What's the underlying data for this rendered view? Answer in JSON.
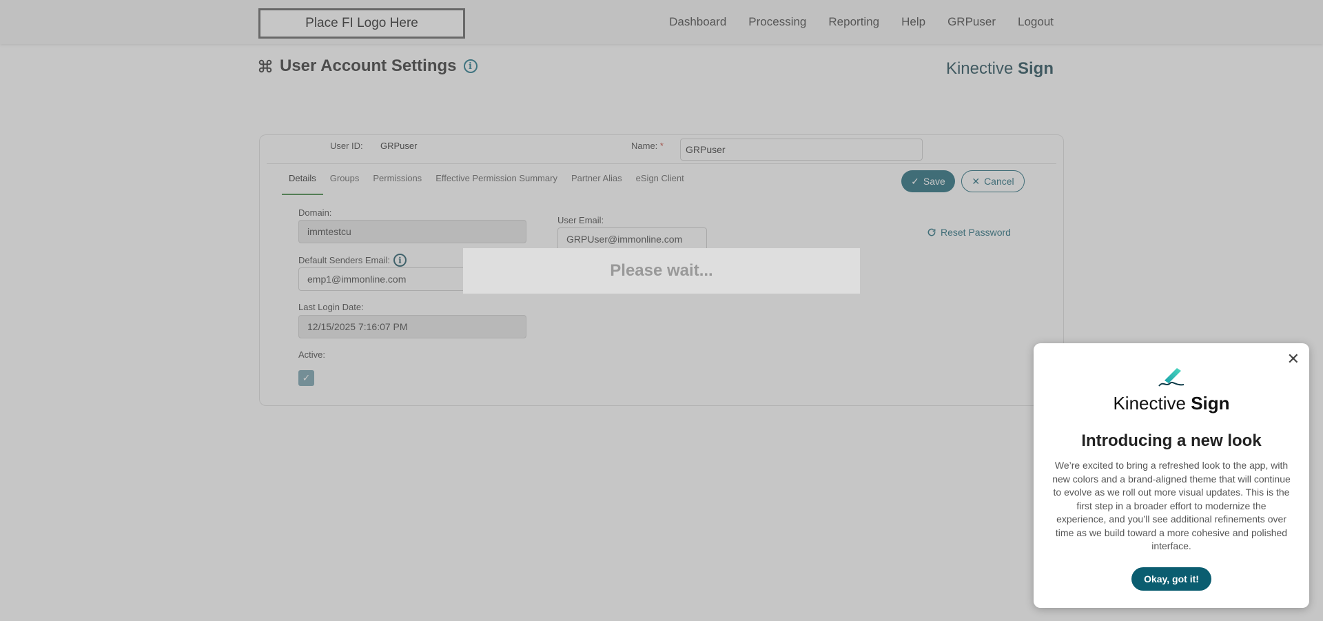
{
  "header": {
    "logo_text": "Place FI Logo Here",
    "nav": [
      "Dashboard",
      "Processing",
      "Reporting",
      "Help",
      "GRPuser",
      "Logout"
    ]
  },
  "page": {
    "title": "User Account Settings",
    "brand_light": "Kinective",
    "brand_bold": "Sign"
  },
  "form": {
    "user_id_label": "User ID:",
    "user_id_value": "GRPuser",
    "name_label": "Name:",
    "name_required": "*",
    "name_value": "GRPuser",
    "tabs": [
      "Details",
      "Groups",
      "Permissions",
      "Effective Permission Summary",
      "Partner Alias",
      "eSign Client"
    ],
    "save_label": "Save",
    "cancel_label": "Cancel",
    "domain_label": "Domain:",
    "domain_value": "immtestcu",
    "default_email_label": "Default Senders Email:",
    "default_email_value": "emp1@immonline.com",
    "last_login_label": "Last Login Date:",
    "last_login_value": "12/15/2025 7:16:07 PM",
    "active_label": "Active:",
    "user_email_label": "User Email:",
    "user_email_value": "GRPUser@immonline.com",
    "reset_password_label": "Reset Password"
  },
  "overlay": {
    "wait_text": "Please wait..."
  },
  "popup": {
    "brand_light": "Kinective",
    "brand_bold": "Sign",
    "title": "Introducing a new look",
    "body": "We’re excited to bring a refreshed look to the app, with new colors and a brand-aligned theme that will continue to evolve as we roll out more visual updates. This is the first step in a broader effort to modernize the experience, and you’ll see additional refinements over time as we build toward a more cohesive and polished interface.",
    "ok_label": "Okay, got it!"
  },
  "colors": {
    "accent": "#0b5d70",
    "tab_active": "#2e7d32"
  }
}
